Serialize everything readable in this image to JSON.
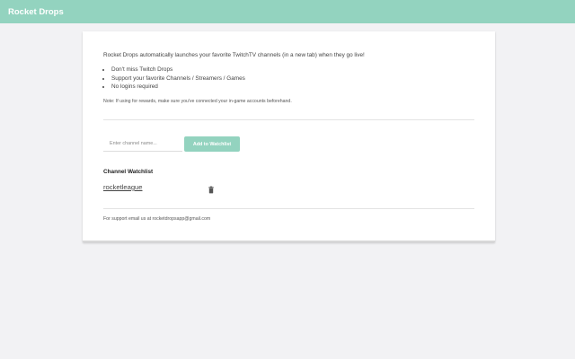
{
  "header": {
    "title": "Rocket Drops"
  },
  "intro": {
    "text": "Rocket Drops automatically launches your favorite TwitchTV channels (in a new tab) when they go live!"
  },
  "features": [
    "Don't miss Twitch Drops",
    "Support your favorite Channels / Streamers / Games",
    "No logins required"
  ],
  "note": {
    "text": "Note: If using for rewards, make sure you've connected your in-game accounts beforehand."
  },
  "add_channel": {
    "placeholder": "Enter channel name...",
    "value": "",
    "button_label": "Add to Watchlist"
  },
  "watchlist": {
    "title": "Channel Watchlist",
    "channels": [
      {
        "name": "rocketleague",
        "delete_icon": "trash-icon"
      }
    ]
  },
  "footer": {
    "support_text": "For support email us at rocketdropsapp@gmail.com"
  },
  "colors": {
    "accent": "#93d3bf",
    "background": "#f2f2f4",
    "card": "#ffffff"
  }
}
